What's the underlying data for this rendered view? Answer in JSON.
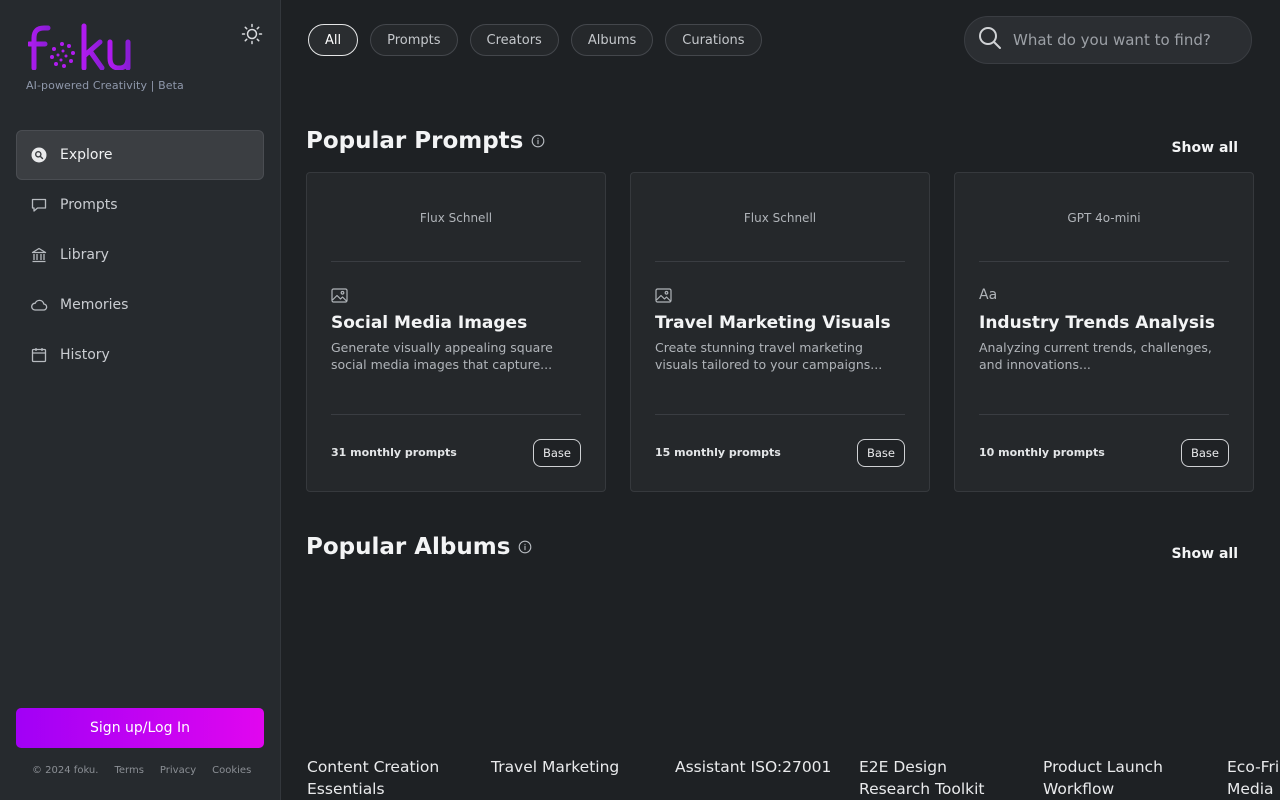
{
  "brand": {
    "logo_text": "foku",
    "tagline": "AI-powered Creativity | Beta",
    "accent_color": "#b01bf0",
    "button_gradient": [
      "#a100f6",
      "#e106ef"
    ]
  },
  "sidebar": {
    "items": [
      {
        "label": "Explore",
        "icon": "explore-icon",
        "active": true
      },
      {
        "label": "Prompts",
        "icon": "chat-bubble-icon",
        "active": false
      },
      {
        "label": "Library",
        "icon": "library-icon",
        "active": false
      },
      {
        "label": "Memories",
        "icon": "cloud-icon",
        "active": false
      },
      {
        "label": "History",
        "icon": "calendar-icon",
        "active": false
      }
    ],
    "signup_label": "Sign up/Log In",
    "footer": {
      "copyright": "© 2024 foku.",
      "terms": "Terms",
      "privacy": "Privacy",
      "cookies": "Cookies"
    }
  },
  "filters": [
    {
      "label": "All",
      "active": true
    },
    {
      "label": "Prompts",
      "active": false
    },
    {
      "label": "Creators",
      "active": false
    },
    {
      "label": "Albums",
      "active": false
    },
    {
      "label": "Curations",
      "active": false
    }
  ],
  "search": {
    "placeholder": "What do you want to find?",
    "value": ""
  },
  "popular_prompts": {
    "title": "Popular Prompts",
    "show_all": "Show all",
    "cards": [
      {
        "model": "Flux Schnell",
        "type_icon": "image-icon",
        "type_text": "",
        "title": "Social Media Images",
        "description": "Generate visually appealing square social media images that capture...",
        "count": "31 monthly prompts",
        "badge": "Base"
      },
      {
        "model": "Flux Schnell",
        "type_icon": "image-icon",
        "type_text": "",
        "title": "Travel Marketing Visuals",
        "description": "Create stunning travel marketing visuals tailored to your campaigns...",
        "count": "15 monthly prompts",
        "badge": "Base"
      },
      {
        "model": "GPT 4o-mini",
        "type_icon": "text-icon",
        "type_text": "Aa",
        "title": "Industry Trends Analysis",
        "description": "Analyzing current trends, challenges, and innovations...",
        "count": "10 monthly prompts",
        "badge": "Base"
      }
    ]
  },
  "popular_albums": {
    "title": "Popular Albums",
    "show_all": "Show all",
    "items": [
      {
        "title": "Content Creation Essentials"
      },
      {
        "title": "Travel Marketing"
      },
      {
        "title": "Assistant ISO:27001"
      },
      {
        "title": "E2E Design Research Toolkit"
      },
      {
        "title": "Product Launch Workflow"
      },
      {
        "title": "Eco-Friendly Social Media"
      }
    ]
  }
}
